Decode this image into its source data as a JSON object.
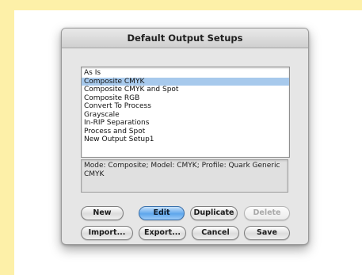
{
  "dialog": {
    "title": "Default Output Setups"
  },
  "list": {
    "items": [
      "As Is",
      "Composite CMYK",
      "Composite CMYK and Spot",
      "Composite RGB",
      "Convert To Process",
      "Grayscale",
      "In-RIP Separations",
      "Process and Spot",
      "New Output Setup1"
    ],
    "selected_index": 1
  },
  "description": {
    "text": "Mode: Composite; Model: CMYK; Profile: Quark Generic CMYK"
  },
  "buttons": {
    "new": "New",
    "edit": "Edit",
    "duplicate": "Duplicate",
    "delete": "Delete",
    "import": "Import...",
    "export": "Export...",
    "cancel": "Cancel",
    "save": "Save"
  },
  "colors": {
    "page_background": "#fdf0a8",
    "selection": "#a7c9ec",
    "default_button": "#5ea6ec"
  }
}
